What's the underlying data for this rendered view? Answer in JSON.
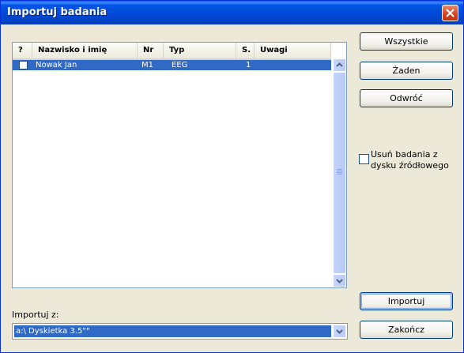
{
  "window": {
    "title": "Importuj badania"
  },
  "list": {
    "columns": [
      "?",
      "Nazwisko i imię",
      "Nr",
      "Typ",
      "S.",
      "Uwagi"
    ],
    "rows": [
      {
        "name": "Nowak Jan",
        "nr": "M1",
        "typ": "EEG",
        "s": "1",
        "uwagi": ""
      }
    ]
  },
  "buttons": {
    "all": "Wszystkie",
    "none": "Żaden",
    "invert": "Odwróć",
    "import": "Importuj",
    "close": "Zakończ"
  },
  "delete_source": {
    "label": "Usuń badania z dysku źródłowego",
    "checked": false
  },
  "import_from": {
    "label": "Importuj z:",
    "value": "a:\\ Dyskietka 3.5\"\""
  },
  "colors": {
    "title_bar": "#0054e3",
    "selection": "#316ac5",
    "dialog_bg": "#ece9d8"
  }
}
